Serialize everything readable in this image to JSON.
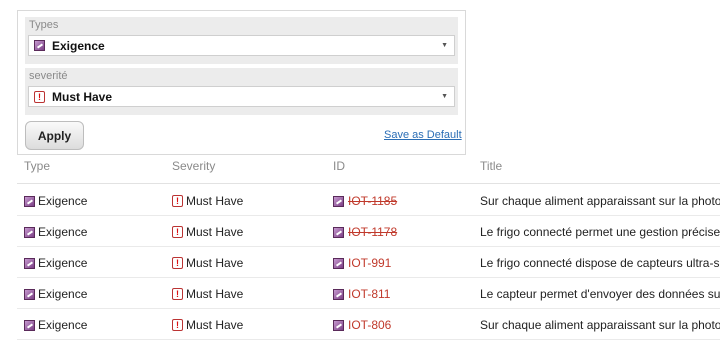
{
  "filters": {
    "types": {
      "label": "Types",
      "value": "Exigence",
      "icon": "exigence-icon"
    },
    "severity": {
      "label": "severité",
      "value": "Must Have",
      "icon": "must-have-icon"
    },
    "apply_label": "Apply",
    "save_default_label": "Save as Default"
  },
  "table": {
    "headers": [
      "Type",
      "Severity",
      "ID",
      "Title"
    ],
    "rows": [
      {
        "type": "Exigence",
        "severity": "Must Have",
        "id": "IOT-1185",
        "struck": true,
        "title": "Sur chaque aliment apparaissant sur la photo, r"
      },
      {
        "type": "Exigence",
        "severity": "Must Have",
        "id": "IOT-1178",
        "struck": true,
        "title": "Le frigo connecté permet une gestion précise d"
      },
      {
        "type": "Exigence",
        "severity": "Must Have",
        "id": "IOT-991",
        "struck": false,
        "title": "Le frigo connecté dispose de capteurs ultra-sen"
      },
      {
        "type": "Exigence",
        "severity": "Must Have",
        "id": "IOT-811",
        "struck": false,
        "title": "Le capteur permet d'envoyer des données sur le"
      },
      {
        "type": "Exigence",
        "severity": "Must Have",
        "id": "IOT-806",
        "struck": false,
        "title": "Sur chaque aliment apparaissant sur la photo, r"
      }
    ]
  },
  "colors": {
    "id_link": "#c0392b",
    "link": "#2a6db5",
    "exigence_icon": "#7b3f86",
    "must_have_icon": "#dd1111"
  }
}
